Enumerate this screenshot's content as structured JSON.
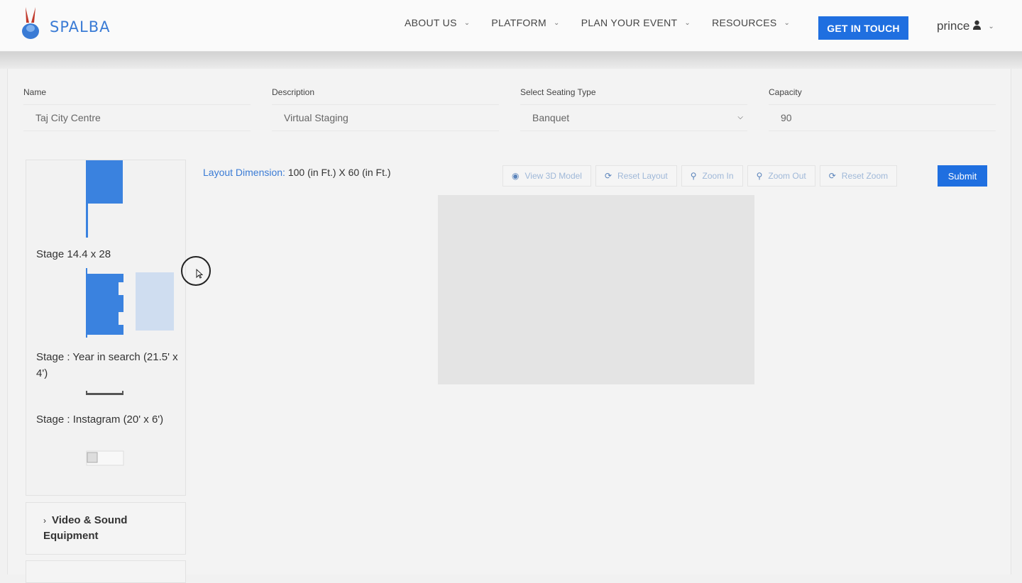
{
  "brand": {
    "name": "SPALBA",
    "colors": {
      "primary": "#1f6fe0",
      "logo_blue": "#3a7bd5",
      "logo_red": "#c0392b"
    }
  },
  "nav": {
    "items": [
      {
        "label": "ABOUT US"
      },
      {
        "label": "PLATFORM"
      },
      {
        "label": "PLAN YOUR EVENT"
      },
      {
        "label": "RESOURCES"
      }
    ],
    "cta_label": "GET IN TOUCH",
    "user": {
      "name": "prince",
      "icon": "user-icon"
    }
  },
  "form": {
    "name": {
      "label": "Name",
      "value": "Taj City Centre"
    },
    "description": {
      "label": "Description",
      "value": "Virtual Staging"
    },
    "seating": {
      "label": "Select Seating Type",
      "value": "Banquet"
    },
    "capacity": {
      "label": "Capacity",
      "value": "90"
    }
  },
  "sidebar": {
    "items": [
      {
        "label": "Stage 14.4 x 28",
        "icon": "stage-icon"
      },
      {
        "label": "Stage : Year in search (21.5' x 4')",
        "icon": "stage-icon"
      },
      {
        "label": "Stage : Instagram (20' x 6')",
        "icon": "stage-icon"
      },
      {
        "label": "",
        "icon": "broken-image-icon"
      }
    ],
    "accordion": {
      "label": "Video & Sound Equipment",
      "icon": "chevron-right-icon"
    }
  },
  "layout": {
    "dimension_label": "Layout Dimension:",
    "dimension_value": "100 (in Ft.) X 60 (in Ft.)"
  },
  "toolbar": {
    "buttons": [
      {
        "label": "View 3D Model",
        "icon": "eye-icon"
      },
      {
        "label": "Reset Layout",
        "icon": "refresh-icon"
      },
      {
        "label": "Zoom In",
        "icon": "zoom-in-icon"
      },
      {
        "label": "Zoom Out",
        "icon": "zoom-out-icon"
      },
      {
        "label": "Reset Zoom",
        "icon": "refresh-icon"
      }
    ],
    "submit_label": "Submit"
  }
}
